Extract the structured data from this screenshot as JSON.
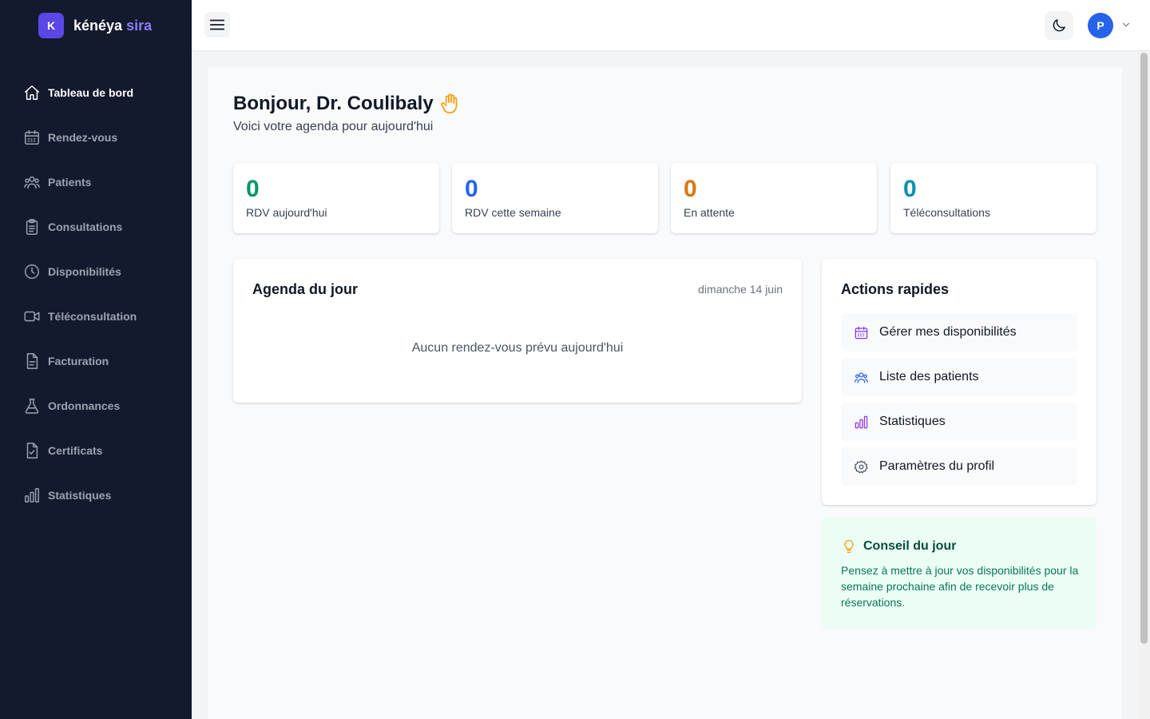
{
  "brand": {
    "logo_letter": "K",
    "name": "kénéya",
    "accent": "sira",
    "accent_color": "#8b7cf6",
    "logo_color": "#5b47e6"
  },
  "sidebar": {
    "items": [
      {
        "label": "Tableau de bord",
        "icon": "home-icon",
        "active": true
      },
      {
        "label": "Rendez-vous",
        "icon": "calendar-icon",
        "active": false
      },
      {
        "label": "Patients",
        "icon": "users-icon",
        "active": false
      },
      {
        "label": "Consultations",
        "icon": "clipboard-icon",
        "active": false
      },
      {
        "label": "Disponibilités",
        "icon": "clock-icon",
        "active": false
      },
      {
        "label": "Téléconsultation",
        "icon": "video-icon",
        "active": false
      },
      {
        "label": "Facturation",
        "icon": "document-icon",
        "active": false
      },
      {
        "label": "Ordonnances",
        "icon": "flask-icon",
        "active": false
      },
      {
        "label": "Certificats",
        "icon": "certificate-icon",
        "active": false
      },
      {
        "label": "Statistiques",
        "icon": "bar-chart-icon",
        "active": false
      }
    ]
  },
  "topbar": {
    "menu_icon": "hamburger-icon",
    "theme_icon": "moon-icon",
    "avatar_letter": "P",
    "avatar_color": "#2563eb",
    "caret_icon": "chevron-down-icon"
  },
  "greeting": {
    "title": "Bonjour, Dr. Coulibaly",
    "icon": "hand-wave-icon",
    "subtitle": "Voici votre agenda pour aujourd'hui"
  },
  "stats": [
    {
      "value": "0",
      "label": "RDV aujourd'hui",
      "color": "#059669"
    },
    {
      "value": "0",
      "label": "RDV cette semaine",
      "color": "#2563eb"
    },
    {
      "value": "0",
      "label": "En attente",
      "color": "#d97706"
    },
    {
      "value": "0",
      "label": "Téléconsultations",
      "color": "#0891b2"
    }
  ],
  "agenda": {
    "title": "Agenda du jour",
    "date": "dimanche 14 juin",
    "empty": "Aucun rendez-vous prévu aujourd'hui"
  },
  "actions": {
    "title": "Actions rapides",
    "items": [
      {
        "label": "Gérer mes disponibilités",
        "icon": "calendar-icon",
        "color": "#7c3aed"
      },
      {
        "label": "Liste des patients",
        "icon": "users-icon",
        "color": "#2563eb"
      },
      {
        "label": "Statistiques",
        "icon": "bar-chart-icon",
        "color": "#9333ea"
      },
      {
        "label": "Paramètres du profil",
        "icon": "gear-icon",
        "color": "#4b5563"
      }
    ]
  },
  "tip": {
    "icon": "lightbulb-icon",
    "title": "Conseil du jour",
    "text": "Pensez à mettre à jour vos disponibilités pour la semaine prochaine afin de recevoir plus de réservations."
  }
}
